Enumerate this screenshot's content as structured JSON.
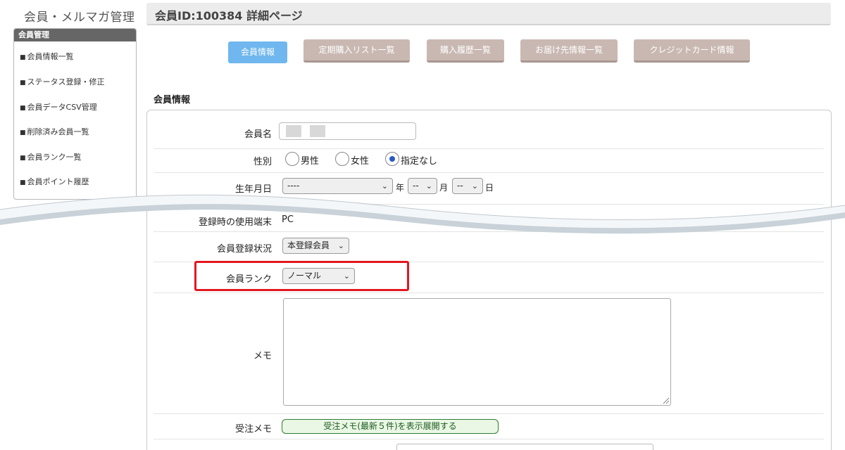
{
  "app_title": "会員・メルマガ管理",
  "sidebar": {
    "heading": "会員管理",
    "bullet": "■",
    "items": [
      {
        "label": "会員情報一覧"
      },
      {
        "label": "ステータス登録・修正"
      },
      {
        "label": "会員データCSV管理"
      },
      {
        "label": "削除済み会員一覧"
      },
      {
        "label": "会員ランク一覧"
      },
      {
        "label": "会員ポイント履歴"
      }
    ]
  },
  "header": {
    "title": "会員ID:100384 詳細ページ"
  },
  "tabs": [
    {
      "label": "会員情報",
      "active": true
    },
    {
      "label": "定期購入リスト一覧",
      "active": false
    },
    {
      "label": "購入履歴一覧",
      "active": false
    },
    {
      "label": "お届け先情報一覧",
      "active": false
    },
    {
      "label": "クレジットカード情報",
      "active": false
    }
  ],
  "section_title": "会員情報",
  "form": {
    "name": {
      "label": "会員名"
    },
    "gender": {
      "label": "性別",
      "options": [
        "男性",
        "女性",
        "指定なし"
      ],
      "selected": "指定なし"
    },
    "birthdate": {
      "label": "生年月日",
      "year_value": "----",
      "year_unit": "年",
      "month_value": "--",
      "month_unit": "月",
      "day_value": "--",
      "day_unit": "日"
    },
    "device": {
      "label": "登録時の使用端末",
      "value": "PC"
    },
    "status": {
      "label": "会員登録状況",
      "value": "本登録会員"
    },
    "rank": {
      "label": "会員ランク",
      "value": "ノーマル"
    },
    "memo": {
      "label": "メモ",
      "value": ""
    },
    "order_memo": {
      "label": "受注メモ",
      "button_label": "受注メモ(最新５件)を表示展開する"
    }
  },
  "colors": {
    "tab_active": "#6fb7ee",
    "tab_inactive": "#c9b8b2",
    "highlight": "#e3171f",
    "radio_checked": "#2b59c3",
    "memo_button": "#e9f7e4"
  },
  "icons": {
    "select_arrow": "chevron-down-icon",
    "resize": "resize-grip-icon"
  }
}
